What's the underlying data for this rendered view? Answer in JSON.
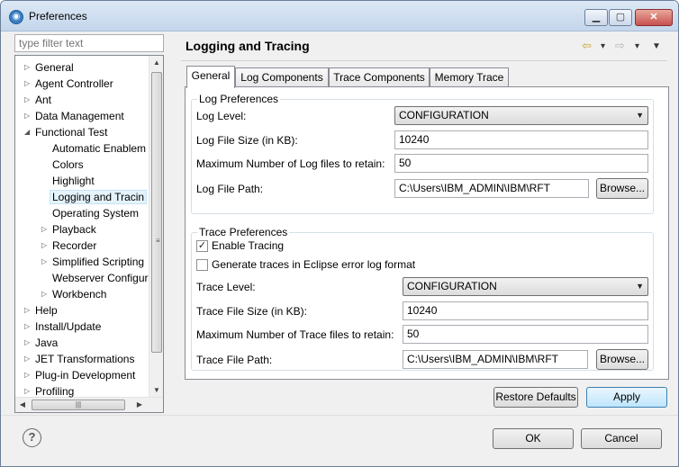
{
  "window": {
    "title": "Preferences",
    "minimize": "▁",
    "maximize": "▢",
    "close": "✕"
  },
  "filter": {
    "placeholder": "type filter text"
  },
  "tree": [
    {
      "label": "General",
      "depth": 0,
      "twisty": "▷"
    },
    {
      "label": "Agent Controller",
      "depth": 0,
      "twisty": "▷"
    },
    {
      "label": "Ant",
      "depth": 0,
      "twisty": "▷"
    },
    {
      "label": "Data Management",
      "depth": 0,
      "twisty": "▷"
    },
    {
      "label": "Functional Test",
      "depth": 0,
      "twisty": "◢"
    },
    {
      "label": "Automatic Enablem",
      "depth": 1,
      "twisty": ""
    },
    {
      "label": "Colors",
      "depth": 1,
      "twisty": ""
    },
    {
      "label": "Highlight",
      "depth": 1,
      "twisty": ""
    },
    {
      "label": "Logging and Tracin",
      "depth": 1,
      "twisty": "",
      "selected": true
    },
    {
      "label": "Operating System",
      "depth": 1,
      "twisty": ""
    },
    {
      "label": "Playback",
      "depth": 1,
      "twisty": "▷"
    },
    {
      "label": "Recorder",
      "depth": 1,
      "twisty": "▷"
    },
    {
      "label": "Simplified Scripting",
      "depth": 1,
      "twisty": "▷"
    },
    {
      "label": "Webserver Configur",
      "depth": 1,
      "twisty": ""
    },
    {
      "label": "Workbench",
      "depth": 1,
      "twisty": "▷"
    },
    {
      "label": "Help",
      "depth": 0,
      "twisty": "▷"
    },
    {
      "label": "Install/Update",
      "depth": 0,
      "twisty": "▷"
    },
    {
      "label": "Java",
      "depth": 0,
      "twisty": "▷"
    },
    {
      "label": "JET Transformations",
      "depth": 0,
      "twisty": "▷"
    },
    {
      "label": "Plug-in Development",
      "depth": 0,
      "twisty": "▷"
    },
    {
      "label": "Profiling",
      "depth": 0,
      "twisty": "▷"
    }
  ],
  "header": {
    "title": "Logging and Tracing",
    "back": "⇦",
    "forward": "⇨",
    "dropdown": "▾",
    "menu": "▼"
  },
  "tabs": [
    "General",
    "Log Components",
    "Trace Components",
    "Memory Trace"
  ],
  "log": {
    "legend": "Log Preferences",
    "level_label": "Log Level:",
    "level_value": "CONFIGURATION",
    "size_label": "Log File Size (in KB):",
    "size_value": "10240",
    "max_label": "Maximum Number of Log files to retain:",
    "max_value": "50",
    "path_label": "Log File Path:",
    "path_value": "C:\\Users\\IBM_ADMIN\\IBM\\RFT",
    "browse": "Browse..."
  },
  "trace": {
    "legend": "Trace Preferences",
    "enable_label": "Enable Tracing",
    "enable_checked": true,
    "eclipse_label": "Generate traces in Eclipse error log format",
    "eclipse_checked": false,
    "level_label": "Trace Level:",
    "level_value": "CONFIGURATION",
    "size_label": "Trace File Size (in KB):",
    "size_value": "10240",
    "max_label": "Maximum Number of Trace files to retain:",
    "max_value": "50",
    "path_label": "Trace File Path:",
    "path_value": "C:\\Users\\IBM_ADMIN\\IBM\\RFT",
    "browse": "Browse..."
  },
  "actions": {
    "restore": "Restore Defaults",
    "apply": "Apply",
    "ok": "OK",
    "cancel": "Cancel",
    "help": "?"
  },
  "scroll": {
    "up": "▲",
    "down": "▼",
    "left": "◀",
    "right": "▶",
    "grip": "≡",
    "hgrip": "|||"
  }
}
